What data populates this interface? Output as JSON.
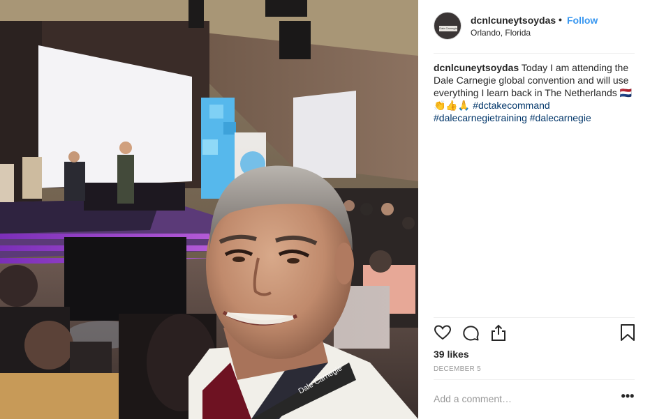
{
  "post": {
    "username": "dcnlcuneytsoydas",
    "separator": "•",
    "follow_label": "Follow",
    "location": "Orlando, Florida",
    "avatar_text": "Dale Carnegie",
    "caption": {
      "user": "dcnlcuneytsoydas",
      "text": " Today I am attending the Dale Carnegie global convention and will use everything I learn back in The Netherlands ",
      "emojis": "🇳🇱👏👍🙏",
      "hashtags": [
        "#dctakecommand",
        "#dalecarnegietraining",
        "#dalecarnegie"
      ]
    },
    "likes": "39 likes",
    "date": "DECEMBER 5",
    "comment_placeholder": "Add a comment…",
    "more_label": "•••",
    "lanyard_text": "Dale Carnegie"
  },
  "icons": {
    "like": "heart-outline-icon",
    "comment": "speech-bubble-icon",
    "share": "share-upload-icon",
    "save": "bookmark-icon"
  },
  "colors": {
    "follow": "#3897f0",
    "hashtag": "#003569",
    "meta_gray": "#999999"
  }
}
